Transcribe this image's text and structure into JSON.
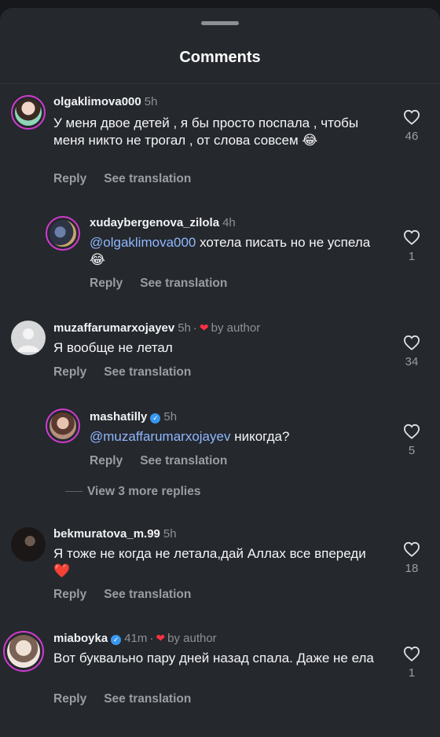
{
  "header": {
    "title": "Comments"
  },
  "actions": {
    "reply": "Reply",
    "see_translation": "See translation"
  },
  "view_more": "View 3 more replies",
  "comments": [
    {
      "username": "olgaklimova000",
      "time": "5h",
      "verified": false,
      "liked_by_author": false,
      "text": "У меня двое детей , я бы просто поспала , чтобы меня никто не трогал , от слова совсем 😂",
      "likes": "46"
    },
    {
      "username": "xudaybergenova_zilola",
      "time": "4h",
      "verified": false,
      "liked_by_author": false,
      "mention": "@olgaklimova000",
      "text": " хотела писать но не успела 😂",
      "likes": "1"
    },
    {
      "username": "muzaffarumarxojayev",
      "time": "5h",
      "verified": false,
      "liked_by_author": true,
      "by_author_label": "by author",
      "text": "Я вообще не летал",
      "likes": "34"
    },
    {
      "username": "mashatilly",
      "time": "5h",
      "verified": true,
      "liked_by_author": false,
      "mention": "@muzaffarumarxojayev",
      "text": " никогда?",
      "likes": "5"
    },
    {
      "username": "bekmuratova_m.99",
      "time": "5h",
      "verified": false,
      "liked_by_author": false,
      "text": "Я тоже не когда не летала,дай Аллах все впереди ❤️",
      "likes": "18"
    },
    {
      "username": "miaboyka",
      "time": "41m",
      "verified": true,
      "liked_by_author": true,
      "by_author_label": "by author",
      "text": "Вот буквально пару дней назад спала. Даже не ела",
      "likes": "1"
    }
  ],
  "colors": {
    "background": "#25282d",
    "mention": "#8fb7ff",
    "liked_heart": "#ff3040",
    "verified": "#3897f0"
  }
}
